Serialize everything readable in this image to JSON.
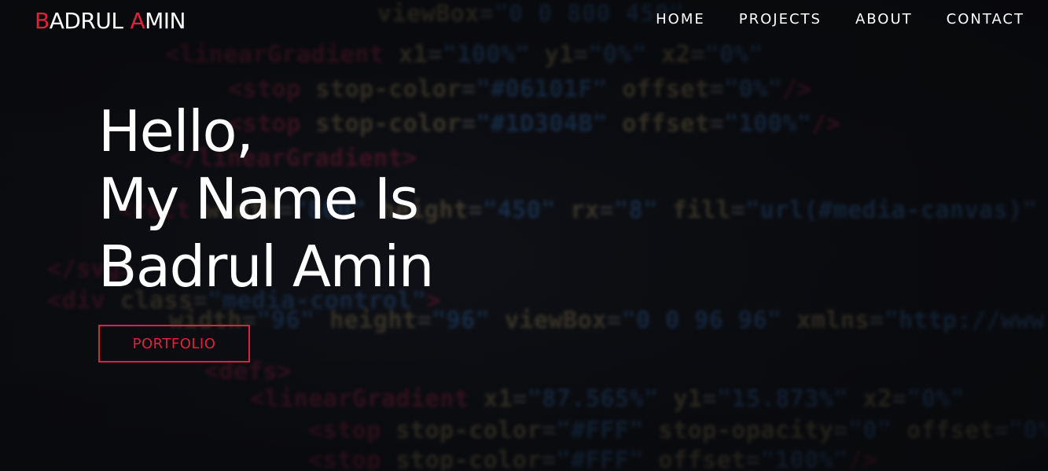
{
  "brand": {
    "initial_first": "B",
    "rest_first": "ADRUL",
    "initial_last": "A",
    "rest_last": "MIN"
  },
  "nav": {
    "items": [
      {
        "label": "HOME"
      },
      {
        "label": "PROJECTS"
      },
      {
        "label": "ABOUT"
      },
      {
        "label": "CONTACT"
      }
    ]
  },
  "hero": {
    "line1": "Hello,",
    "line2": "My Name Is",
    "line3": "Badrul Amin",
    "button_label": "PORTFOLIO"
  },
  "colors": {
    "accent": "#e0213d",
    "background": "#0b0c0f",
    "text": "#ffffff"
  }
}
